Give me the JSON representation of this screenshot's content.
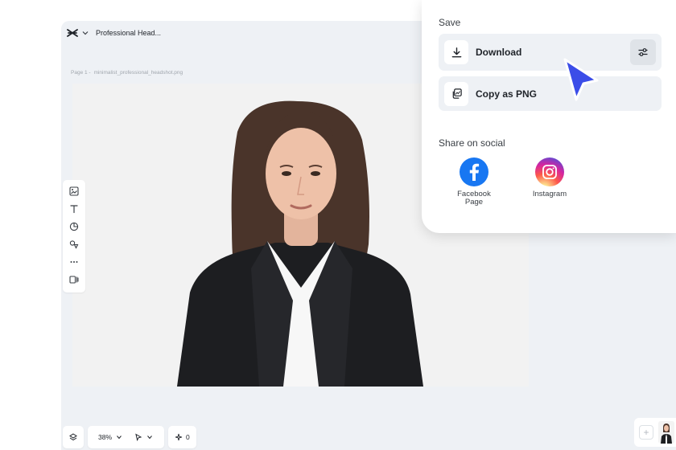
{
  "editor": {
    "project_title": "Professional Head...",
    "breadcrumb_page": "Page 1 -",
    "breadcrumb_file": "minimalist_professional_headshot.png"
  },
  "bottom_bar": {
    "zoom_label": "38%",
    "magic_count": "0"
  },
  "save_panel": {
    "title": "Save",
    "download_label": "Download",
    "copy_label": "Copy as PNG",
    "share_title": "Share on social",
    "facebook_label_line1": "Facebook",
    "facebook_label_line2": "Page",
    "instagram_label": "Instagram"
  },
  "icons": {
    "logo": "capcut-logo-icon",
    "download": "download-icon",
    "copy": "copy-icon",
    "settings": "sliders-icon",
    "facebook": "facebook-icon",
    "instagram": "instagram-icon"
  },
  "colors": {
    "accent_cursor": "#3b4de8",
    "facebook": "#1877f2",
    "panel_row_bg": "#eef1f5"
  }
}
